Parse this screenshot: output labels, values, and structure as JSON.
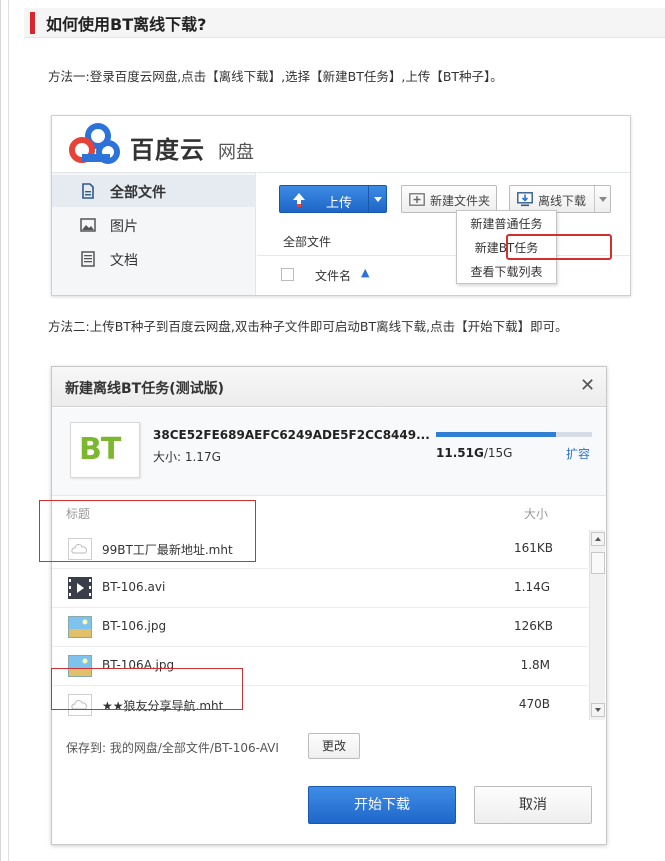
{
  "article": {
    "heading": "如何使用BT离线下载?",
    "method1": "方法一:登录百度云网盘,点击【离线下载】,选择【新建BT任务】,上传【BT种子】。",
    "method2": "方法二:上传BT种子到百度云网盘,双击种子文件即可启动BT离线下载,点击【开始下载】即可。"
  },
  "pan": {
    "logo_text": "百度云",
    "logo_sub": "网盘",
    "sidebar": [
      {
        "label": "全部文件",
        "icon": "file-icon",
        "active": true
      },
      {
        "label": "图片",
        "icon": "image-icon",
        "active": false
      },
      {
        "label": "文档",
        "icon": "document-icon",
        "active": false
      }
    ],
    "toolbar": {
      "upload_label": "上传",
      "new_folder_label": "新建文件夹",
      "offline_label": "离线下载"
    },
    "breadcrumb": "全部文件",
    "list_header": {
      "name_label": "文件名",
      "sort_icon": "sort-ascending-icon"
    },
    "dropdown": [
      "新建普通任务",
      "新建BT任务",
      "查看下载列表"
    ]
  },
  "dialog": {
    "title": "新建离线BT任务(测试版)",
    "close_glyph": "✕",
    "torrent": {
      "icon_text": "BT",
      "hash": "38CE52FE689AEFC6249ADE5F2CC8449...",
      "size": "大小: 1.17G"
    },
    "quota": {
      "used": "11.51G",
      "separator": "/",
      "total": "15G",
      "fraction": 0.77,
      "expand_label": "扩容"
    },
    "columns": {
      "title": "标题",
      "size": "大小"
    },
    "files": [
      {
        "name": "99BT工厂最新地址.mht",
        "size": "161KB",
        "icon": "web-file-icon"
      },
      {
        "name": "BT-106.avi",
        "size": "1.14G",
        "icon": "video-file-icon"
      },
      {
        "name": "BT-106.jpg",
        "size": "126KB",
        "icon": "image-file-icon"
      },
      {
        "name": "BT-106A.jpg",
        "size": "1.8M",
        "icon": "image-file-icon"
      },
      {
        "name": "★★狼友分享导航.mht",
        "size": "470B",
        "icon": "web-file-icon"
      }
    ],
    "save_to": "保存到: 我的网盘/全部文件/BT-106-AVI",
    "change_label": "更改",
    "start_label": "开始下载",
    "cancel_label": "取消"
  },
  "colors": {
    "accent_red": "#d7262c",
    "primary_blue": "#1f67c9",
    "link_blue": "#2b73d8",
    "bt_green": "#7cb82f",
    "highlight_red": "#d03030"
  }
}
